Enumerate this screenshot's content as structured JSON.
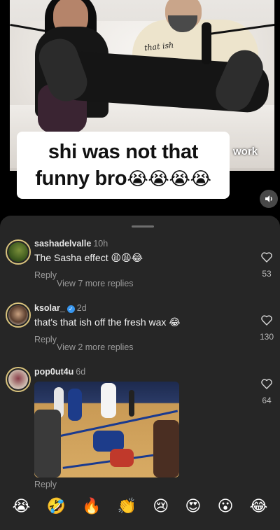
{
  "video": {
    "caption_line1": "shi was not that",
    "caption_line2": "funny bro",
    "caption_emojis": "😭😭😭😭",
    "hoodie_text": "that ish",
    "corner_text": "work"
  },
  "comments": [
    {
      "username": "sashadelvalle",
      "time": "10h",
      "verified": false,
      "text": "The Sasha effect 😩😩😂",
      "reply_label": "Reply",
      "view_more": "View 7 more replies",
      "likes": "53"
    },
    {
      "username": "ksolar_",
      "time": "2d",
      "verified": true,
      "text": "that's that ish off the fresh wax 😂",
      "reply_label": "Reply",
      "view_more": "View 2 more replies",
      "likes": "130"
    },
    {
      "username": "pop0ut4u",
      "time": "6d",
      "verified": false,
      "text": "",
      "reply_label": "Reply",
      "likes": "64"
    }
  ],
  "emoji_bar": [
    "😭",
    "🤣",
    "🔥",
    "👏",
    "😢",
    "😍",
    "😮",
    "😂"
  ],
  "colors": {
    "sheet_bg": "#262626",
    "muted_text": "#9a9a9a",
    "verified_blue": "#3897f0"
  }
}
